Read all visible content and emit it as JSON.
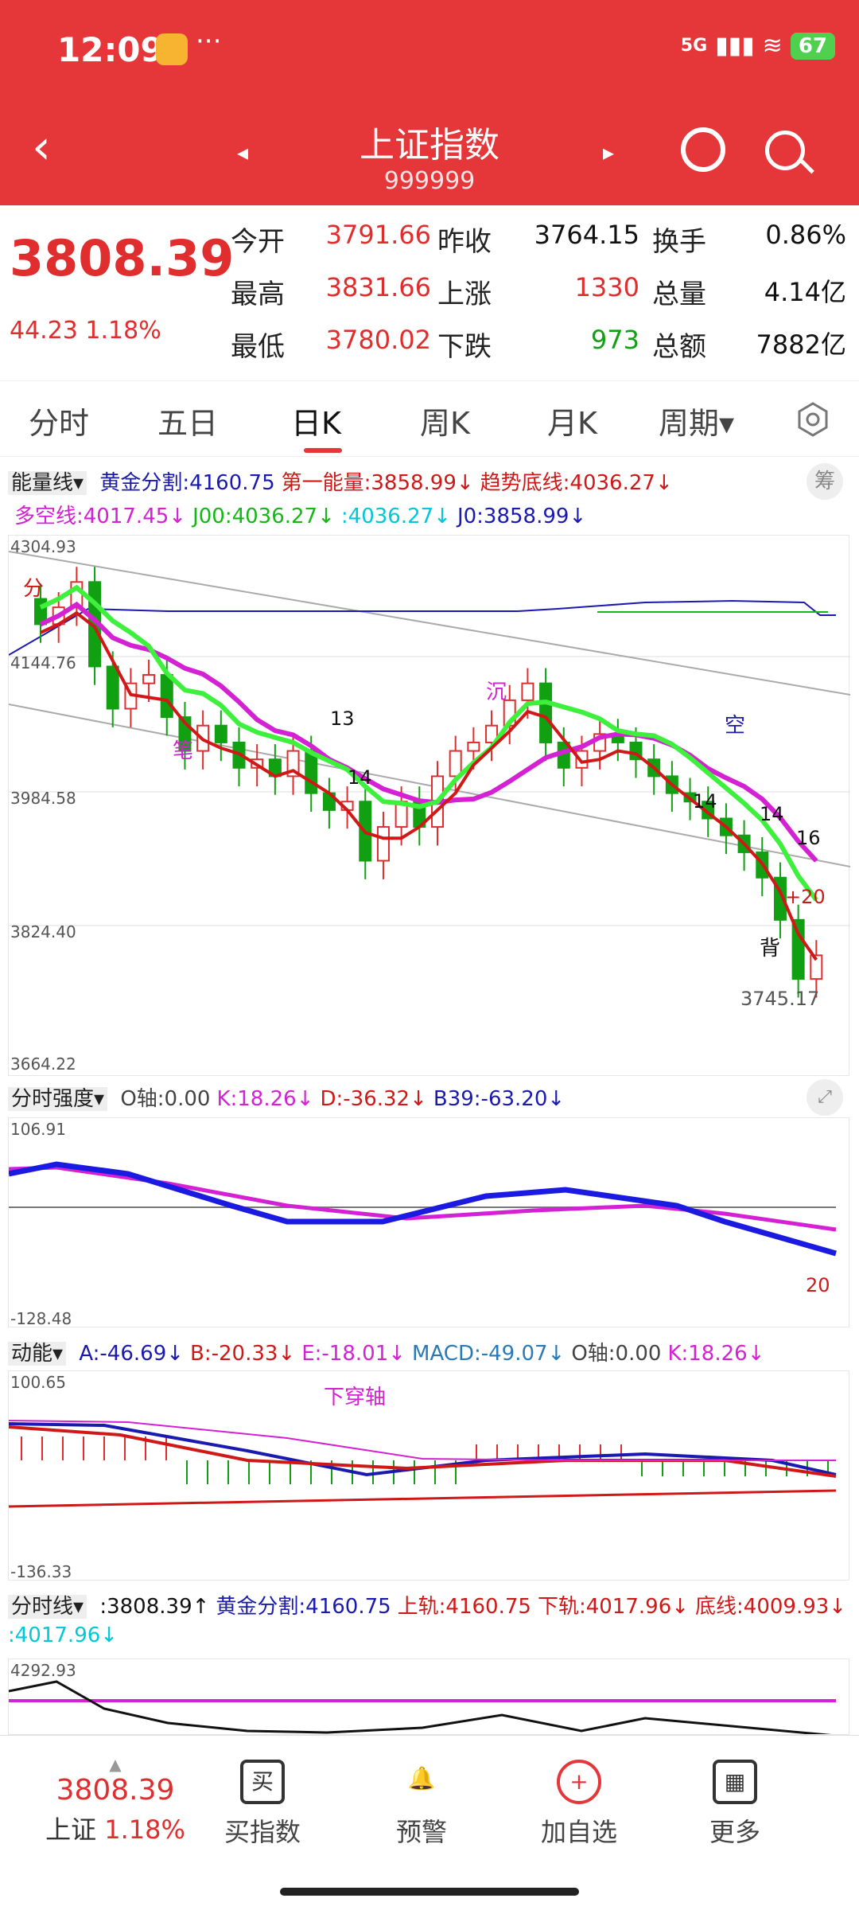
{
  "status_bar": {
    "time": "12:09",
    "dots": "···",
    "network": "5G",
    "battery": "67"
  },
  "nav": {
    "back": "‹",
    "prev": "◂",
    "next": "▸",
    "title": "上证指数",
    "code": "999999"
  },
  "quote": {
    "price": "3808.39",
    "change": "44.23  1.18%",
    "grid": [
      {
        "l1": "今开",
        "v1": "3791.66",
        "l2": "昨收",
        "v2": "3764.15",
        "l3": "换手",
        "v3": "0.86%"
      },
      {
        "l1": "最高",
        "v1": "3831.66",
        "l2": "上涨",
        "v2": "1330",
        "l3": "总量",
        "v3": "4.14亿"
      },
      {
        "l1": "最低",
        "v1": "3780.02",
        "l2": "下跌",
        "v2": "973",
        "l3": "总额",
        "v3": "7882亿"
      }
    ]
  },
  "tabs": [
    "分时",
    "五日",
    "日K",
    "周K",
    "月K",
    "周期▾"
  ],
  "ind1": {
    "name": "能量线▾",
    "items": [
      {
        "t": "黄金分割:4160.75",
        "c": "#1a1ab0"
      },
      {
        "t": "第一能量:3858.99↓",
        "c": "#d01818"
      },
      {
        "t": "趋势底线:4036.27↓",
        "c": "#d01818"
      }
    ],
    "row2": [
      {
        "t": "多空线:4017.45↓",
        "c": "#d321d3"
      },
      {
        "t": "J00:4036.27↓",
        "c": "#14b814"
      },
      {
        "t": ":4036.27↓",
        "c": "#00c8d8"
      },
      {
        "t": "J0:3858.99↓",
        "c": "#1a1ab0"
      }
    ],
    "chip": "筹"
  },
  "main_axis": [
    "4304.93",
    "4144.76",
    "3984.58",
    "3824.40",
    "3664.22"
  ],
  "main_labels": {
    "low": "3745.17",
    "bei": "背",
    "n13": "13",
    "n14a": "14",
    "n14b": "14",
    "n14c": "14",
    "n16": "16",
    "n20": "+20",
    "kong": "空",
    "chen": "沉",
    "bi": "笔",
    "fen": "分"
  },
  "ind2": {
    "name": "分时强度▾",
    "items": [
      {
        "t": "O轴:0.00",
        "c": "#444"
      },
      {
        "t": "K:18.26↓",
        "c": "#d321d3"
      },
      {
        "t": "D:-36.32↓",
        "c": "#d01818"
      },
      {
        "t": "B39:-63.20↓",
        "c": "#1a1ab0"
      }
    ],
    "axis_top": "106.91",
    "axis_bot": "-128.48",
    "end_label": "20"
  },
  "ind3": {
    "name": "动能▾",
    "items": [
      {
        "t": "A:-46.69↓",
        "c": "#1a1ab0"
      },
      {
        "t": "B:-20.33↓",
        "c": "#d01818"
      },
      {
        "t": "E:-18.01↓",
        "c": "#d321d3"
      },
      {
        "t": "MACD:-49.07↓",
        "c": "#2a7ab8"
      },
      {
        "t": "O轴:0.00",
        "c": "#444"
      },
      {
        "t": "K:18.26↓",
        "c": "#d321d3"
      }
    ],
    "axis_top": "100.65",
    "axis_bot": "-136.33",
    "label": "下穿轴"
  },
  "ind4": {
    "name": "分时线▾",
    "items": [
      {
        "t": ":3808.39↑",
        "c": "#111"
      },
      {
        "t": "黄金分割:4160.75",
        "c": "#1a1ab0"
      },
      {
        "t": "上轨:4160.75",
        "c": "#d01818"
      },
      {
        "t": "下轨:4017.96↓",
        "c": "#d01818"
      },
      {
        "t": "底线:4009.93↓",
        "c": "#d01818"
      }
    ],
    "row2": ":4017.96↓",
    "axis_top": "4292.93"
  },
  "bottom": {
    "price": "3808.39",
    "name": "上证",
    "pct": "1.18%",
    "buttons": [
      {
        "label": "买指数",
        "icon": "买"
      },
      {
        "label": "预警",
        "icon": "🔔"
      },
      {
        "label": "加自选",
        "icon": "+"
      },
      {
        "label": "更多",
        "icon": "▦"
      }
    ]
  },
  "chart_data": {
    "type": "candlestick",
    "ylim": [
      3664.22,
      4304.93
    ],
    "close_approx": [
      4200,
      4220,
      4250,
      4150,
      4100,
      4130,
      4140,
      4090,
      4050,
      4080,
      4060,
      4030,
      4040,
      4020,
      4050,
      4000,
      3980,
      3990,
      3920,
      3960,
      3990,
      3960,
      4020,
      4050,
      4060,
      4080,
      4110,
      4130,
      4060,
      4030,
      4050,
      4070,
      4060,
      4040,
      4020,
      4000,
      3990,
      3970,
      3950,
      3930,
      3900,
      3850,
      3780,
      3808
    ],
    "lows_marker": 3745.17
  }
}
